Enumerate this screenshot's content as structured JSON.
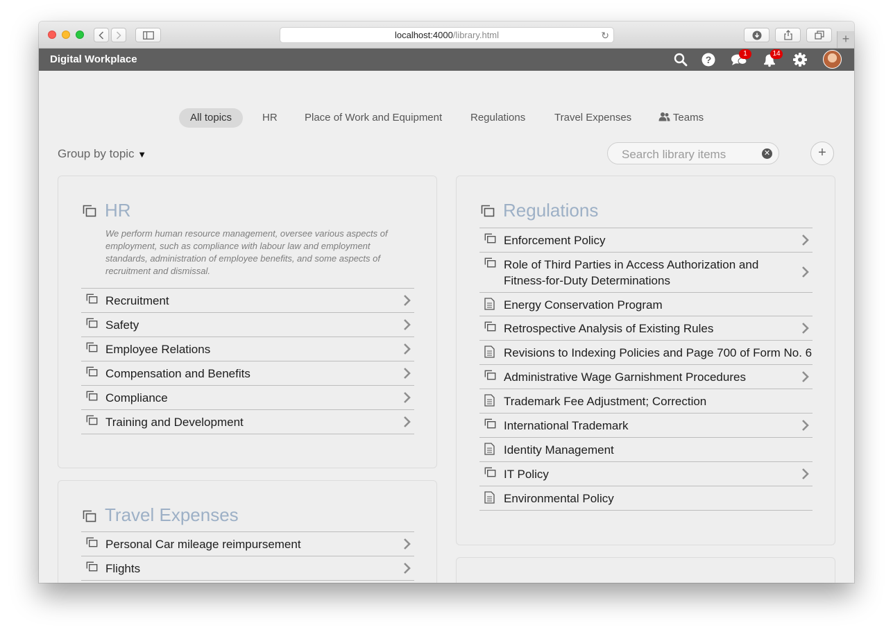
{
  "browser": {
    "url_host": "localhost:4000",
    "url_path": "/library.html"
  },
  "app": {
    "brand": "Digital Workplace",
    "chat_badge": "1",
    "notifications_badge": "14"
  },
  "tabs": [
    {
      "label": "All topics"
    },
    {
      "label": "HR"
    },
    {
      "label": "Place of Work and Equipment"
    },
    {
      "label": "Regulations"
    },
    {
      "label": "Travel Expenses"
    },
    {
      "label": "Teams"
    }
  ],
  "toolbar": {
    "group_by": "Group by topic",
    "search_placeholder": "Search library items"
  },
  "hr": {
    "title": "HR",
    "description": "We perform human resource management, oversee various aspects of employment, such as compliance with labour law and employment standards, administration of employee benefits, and some aspects of recruitment and dismissal.",
    "items": [
      {
        "label": "Recruitment",
        "type": "collection"
      },
      {
        "label": "Safety",
        "type": "collection"
      },
      {
        "label": "Employee Relations",
        "type": "collection"
      },
      {
        "label": "Compensation and Benefits",
        "type": "collection"
      },
      {
        "label": "Compliance",
        "type": "collection"
      },
      {
        "label": "Training and Development",
        "type": "collection"
      }
    ]
  },
  "travel": {
    "title": "Travel Expenses",
    "items": [
      {
        "label": "Personal Car mileage reimpursement",
        "type": "collection"
      },
      {
        "label": "Flights",
        "type": "collection"
      }
    ]
  },
  "regulations": {
    "title": "Regulations",
    "items": [
      {
        "label": "Enforcement Policy",
        "type": "collection"
      },
      {
        "label": "Role of Third Parties in Access Authorization and Fitness-for-Duty Determinations",
        "type": "collection"
      },
      {
        "label": "Energy Conservation Program",
        "type": "document"
      },
      {
        "label": "Retrospective Analysis of Existing Rules",
        "type": "collection"
      },
      {
        "label": "Revisions to Indexing Policies and Page 700 of Form No. 6",
        "type": "document"
      },
      {
        "label": "Administrative Wage Garnishment Procedures",
        "type": "collection"
      },
      {
        "label": "Trademark Fee Adjustment; Correction",
        "type": "document"
      },
      {
        "label": "International Trademark",
        "type": "collection"
      },
      {
        "label": "Identity Management",
        "type": "document"
      },
      {
        "label": "IT Policy",
        "type": "collection"
      },
      {
        "label": "Environmental Policy",
        "type": "document"
      }
    ]
  }
}
